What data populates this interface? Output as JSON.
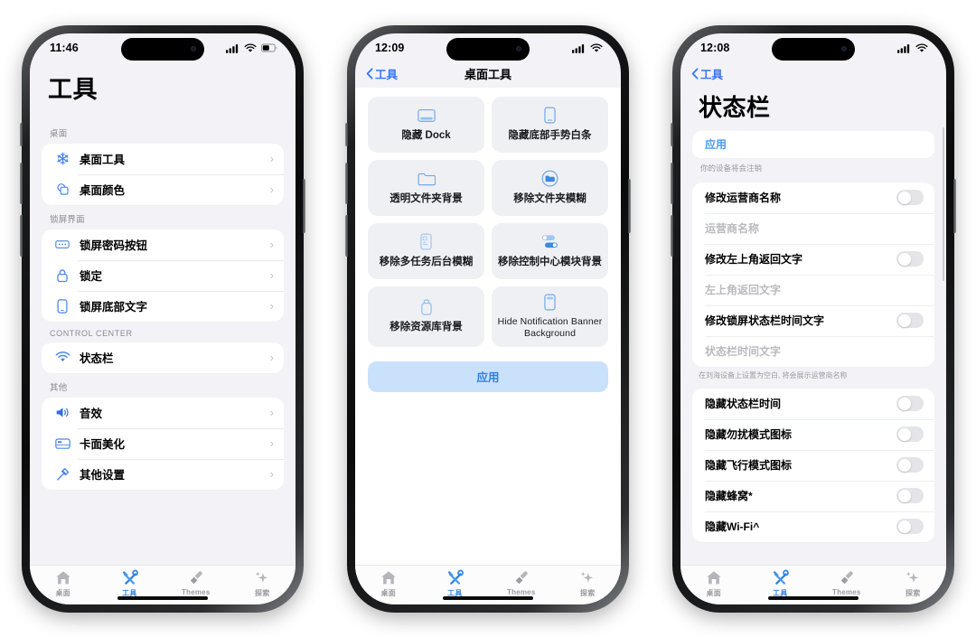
{
  "app": {
    "accent": "#3478f6",
    "tile_bg": "#eff0f4",
    "screen_bg": "#f2f2f7"
  },
  "tabbar": {
    "items": [
      {
        "icon": "home-icon",
        "label": "桌面",
        "active": false
      },
      {
        "icon": "tools-icon",
        "label": "工具",
        "active": true
      },
      {
        "icon": "brush-icon",
        "label": "Themes",
        "active": false
      },
      {
        "icon": "sparkle-icon",
        "label": "探索",
        "active": false
      }
    ]
  },
  "phone1": {
    "status": {
      "time": "11:46",
      "cellular": "signal-icon",
      "wifi": "wifi-icon",
      "battery": "battery-icon"
    },
    "title": "工具",
    "sections": [
      {
        "header": "桌面",
        "rows": [
          {
            "icon": "snowflake-icon",
            "label": "桌面工具"
          },
          {
            "icon": "shapes-icon",
            "label": "桌面颜色"
          }
        ]
      },
      {
        "header": "锁屏界面",
        "rows": [
          {
            "icon": "passcode-icon",
            "label": "锁屏密码按钮"
          },
          {
            "icon": "lock-icon",
            "label": "锁定"
          },
          {
            "icon": "phone-icon",
            "label": "锁屏底部文字"
          }
        ]
      },
      {
        "header": "CONTROL CENTER",
        "caps": true,
        "rows": [
          {
            "icon": "wifi-icon",
            "label": "状态栏"
          }
        ]
      },
      {
        "header": "其他",
        "rows": [
          {
            "icon": "speaker-icon",
            "label": "音效"
          },
          {
            "icon": "card-icon",
            "label": "卡面美化"
          },
          {
            "icon": "hammer-icon",
            "label": "其他设置"
          }
        ]
      }
    ]
  },
  "phone2": {
    "status": {
      "time": "12:09",
      "cellular": "signal-icon",
      "wifi": "wifi-icon"
    },
    "nav": {
      "back_label": "工具",
      "title": "桌面工具"
    },
    "tiles": [
      {
        "icon": "dock-icon",
        "label": "隐藏 Dock",
        "lang": "zh"
      },
      {
        "icon": "phone-bar-icon",
        "label": "隐藏底部手势白条",
        "lang": "zh"
      },
      {
        "icon": "folder-icon",
        "label": "透明文件夹背景",
        "lang": "zh"
      },
      {
        "icon": "folder-circle-icon",
        "label": "移除文件夹模糊",
        "lang": "zh"
      },
      {
        "icon": "multitask-icon",
        "label": "移除多任务后台模糊",
        "lang": "zh"
      },
      {
        "icon": "toggles-icon",
        "label": "移除控制中心模块背景",
        "lang": "zh"
      },
      {
        "icon": "library-icon",
        "label": "移除资源库背景",
        "lang": "zh"
      },
      {
        "icon": "notification-icon",
        "label": "Hide Notification Banner Background",
        "lang": "en"
      }
    ],
    "apply_label": "应用"
  },
  "phone3": {
    "status": {
      "time": "12:08",
      "cellular": "signal-icon",
      "wifi": "wifi-icon"
    },
    "nav": {
      "back_label": "工具"
    },
    "title": "状态栏",
    "apply_label": "应用",
    "apply_note": "你的设备将会注销",
    "group1": [
      {
        "type": "toggle",
        "label": "修改运营商名称",
        "on": false
      },
      {
        "type": "input",
        "placeholder": "运营商名称",
        "value": ""
      },
      {
        "type": "toggle",
        "label": "修改左上角返回文字",
        "on": false
      },
      {
        "type": "input",
        "placeholder": "左上角返回文字",
        "value": ""
      },
      {
        "type": "toggle",
        "label": "修改锁屏状态栏时间文字",
        "on": false
      },
      {
        "type": "input",
        "placeholder": "状态栏时间文字",
        "value": ""
      }
    ],
    "group1_note": "在刘海设备上设置为空白, 将会展示运营商名称",
    "group2": [
      {
        "type": "toggle",
        "label": "隐藏状态栏时间",
        "on": false
      },
      {
        "type": "toggle",
        "label": "隐藏勿扰模式图标",
        "on": false
      },
      {
        "type": "toggle",
        "label": "隐藏飞行模式图标",
        "on": false
      },
      {
        "type": "toggle",
        "label": "隐藏蜂窝*",
        "on": false
      },
      {
        "type": "toggle",
        "label": "隐藏Wi-Fi^",
        "on": false
      }
    ]
  }
}
